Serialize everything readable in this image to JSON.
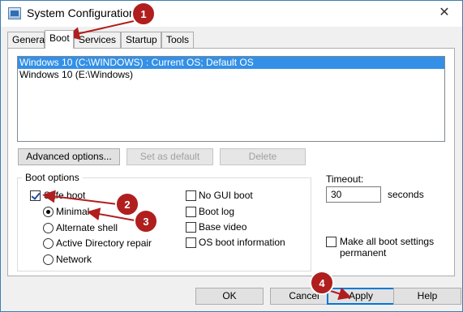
{
  "window": {
    "title": "System Configuration",
    "close_glyph": "✕"
  },
  "tabs": [
    {
      "label": "General"
    },
    {
      "label": "Boot"
    },
    {
      "label": "Services"
    },
    {
      "label": "Startup"
    },
    {
      "label": "Tools"
    }
  ],
  "active_tab": "Boot",
  "os_list": [
    {
      "label": "Windows 10 (C:\\WINDOWS) : Current OS; Default OS",
      "selected": true
    },
    {
      "label": "Windows 10 (E:\\Windows)",
      "selected": false
    }
  ],
  "os_buttons": {
    "advanced": "Advanced options...",
    "set_default": "Set as default",
    "delete": "Delete"
  },
  "boot_options": {
    "legend": "Boot options",
    "safe_boot": {
      "label": "Safe boot",
      "checked": true
    },
    "radios": [
      {
        "label": "Minimal",
        "checked": true
      },
      {
        "label": "Alternate shell",
        "checked": false
      },
      {
        "label": "Active Directory repair",
        "checked": false
      },
      {
        "label": "Network",
        "checked": false
      }
    ],
    "right_checks": [
      {
        "label": "No GUI boot",
        "checked": false
      },
      {
        "label": "Boot log",
        "checked": false
      },
      {
        "label": "Base video",
        "checked": false
      },
      {
        "label": "OS boot information",
        "checked": false
      }
    ]
  },
  "timeout": {
    "label": "Timeout:",
    "value": "30",
    "unit": "seconds"
  },
  "permanent": {
    "line1": "Make all boot settings",
    "line2": "permanent",
    "checked": false
  },
  "footer": {
    "ok": "OK",
    "cancel": "Cancel",
    "apply": "Apply",
    "help": "Help"
  },
  "annotations": [
    {
      "number": "1"
    },
    {
      "number": "2"
    },
    {
      "number": "3"
    },
    {
      "number": "4"
    }
  ],
  "colors": {
    "annotation": "#b01e1e",
    "selection": "#3390e6"
  }
}
